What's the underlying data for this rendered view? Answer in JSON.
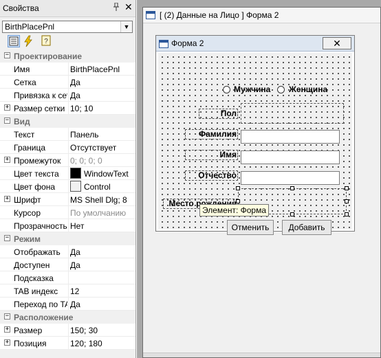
{
  "properties_panel": {
    "title": "Свойства",
    "pin_icon": "pin-icon",
    "close_label": "✕",
    "selected_object": "BirthPlacePnl",
    "categories": [
      {
        "name": "Проектирование",
        "rows": [
          {
            "name": "Имя",
            "value": "BirthPlacePnl"
          },
          {
            "name": "Сетка",
            "value": "Да"
          },
          {
            "name": "Привязка к сетке",
            "value": "Да"
          },
          {
            "name": "Размер сетки",
            "value": "10; 10",
            "expandable": true
          }
        ]
      },
      {
        "name": "Вид",
        "rows": [
          {
            "name": "Текст",
            "value": "Панель"
          },
          {
            "name": "Граница",
            "value": "Отсутствует"
          },
          {
            "name": "Промежуток",
            "value": "0; 0; 0; 0",
            "expandable": true,
            "muted": true
          },
          {
            "name": "Цвет текста",
            "value": "WindowText",
            "swatch": "#000000"
          },
          {
            "name": "Цвет фона",
            "value": "Control",
            "swatch": "#f0f0f0"
          },
          {
            "name": "Шрифт",
            "value": "MS Shell Dlg; 8",
            "expandable": true
          },
          {
            "name": "Курсор",
            "value": "По умолчанию",
            "muted": true
          },
          {
            "name": "Прозрачность",
            "value": "Нет"
          }
        ]
      },
      {
        "name": "Режим",
        "rows": [
          {
            "name": "Отображать",
            "value": "Да"
          },
          {
            "name": "Доступен",
            "value": "Да"
          },
          {
            "name": "Подсказка",
            "value": ""
          },
          {
            "name": "TAB индекс",
            "value": "12"
          },
          {
            "name": "Переход по TAB",
            "value": "Да"
          }
        ]
      },
      {
        "name": "Расположение",
        "rows": [
          {
            "name": "Размер",
            "value": "150; 30",
            "expandable": true
          },
          {
            "name": "Позиция",
            "value": "120; 180",
            "expandable": true
          }
        ]
      }
    ]
  },
  "designer": {
    "window_title": "[ (2) Данные на Лицо ] Форма 2",
    "form": {
      "title": "Форма 2",
      "close_label": "✕",
      "radio_male": "Мужчина",
      "radio_female": "Женщина",
      "label_gender": "Пол",
      "label_surname": "Фамилия",
      "label_name": "Имя",
      "label_patronymic": "Отчество",
      "label_birthplace": "Место рождения",
      "tooltip": "Элемент: Форма",
      "button_change": "Отменить",
      "button_add": "Добавить"
    }
  }
}
